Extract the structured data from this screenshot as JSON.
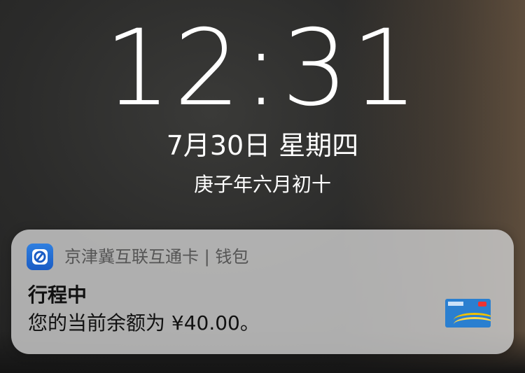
{
  "lockscreen": {
    "time": "12:31",
    "date": "7月30日 星期四",
    "lunar_date": "庚子年六月初十"
  },
  "notification": {
    "app_name": "京津冀互联互通卡 | 钱包",
    "title": "行程中",
    "body": "您的当前余额为 ¥40.00。",
    "icon": "wallet-app-icon",
    "thumbnail": "transit-card-thumbnail"
  },
  "colors": {
    "notification_bg": "#cdcdcd",
    "app_icon": "#2f7fe0",
    "card": "#2a7fd0"
  }
}
